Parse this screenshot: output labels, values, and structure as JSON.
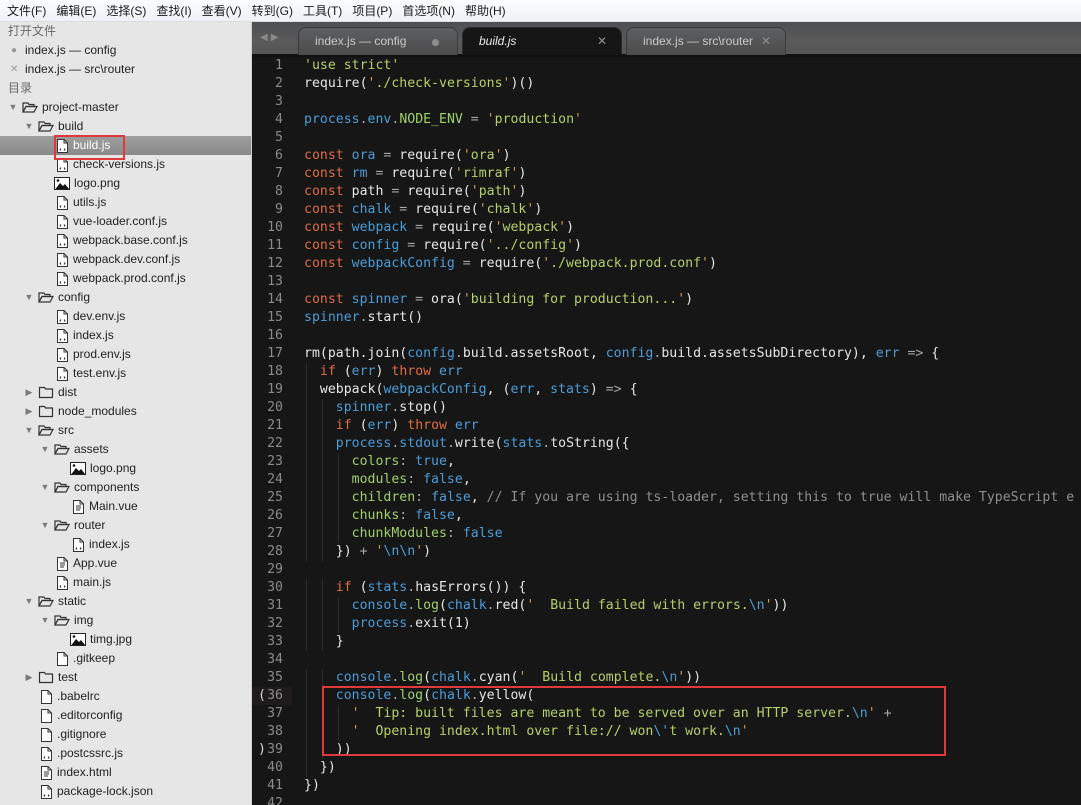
{
  "menu": [
    "文件(F)",
    "编辑(E)",
    "选择(S)",
    "查找(I)",
    "查看(V)",
    "转到(G)",
    "工具(T)",
    "项目(P)",
    "首选项(N)",
    "帮助(H)"
  ],
  "sidebar": {
    "open_files_heading": "打开文件",
    "open_files": [
      {
        "label": "index.js — config",
        "mark": "●"
      },
      {
        "label": "index.js — src\\router",
        "mark": "✕"
      }
    ],
    "folders_heading": "目录",
    "tree": [
      {
        "label": "project-master",
        "type": "folder-open",
        "depth": 0
      },
      {
        "label": "build",
        "type": "folder-open",
        "depth": 1
      },
      {
        "label": "build.js",
        "type": "js",
        "depth": 2,
        "selected": true
      },
      {
        "label": "check-versions.js",
        "type": "js",
        "depth": 2
      },
      {
        "label": "logo.png",
        "type": "image",
        "depth": 2
      },
      {
        "label": "utils.js",
        "type": "js",
        "depth": 2
      },
      {
        "label": "vue-loader.conf.js",
        "type": "js",
        "depth": 2
      },
      {
        "label": "webpack.base.conf.js",
        "type": "js",
        "depth": 2
      },
      {
        "label": "webpack.dev.conf.js",
        "type": "js",
        "depth": 2
      },
      {
        "label": "webpack.prod.conf.js",
        "type": "js",
        "depth": 2
      },
      {
        "label": "config",
        "type": "folder-open",
        "depth": 1
      },
      {
        "label": "dev.env.js",
        "type": "js",
        "depth": 2
      },
      {
        "label": "index.js",
        "type": "js",
        "depth": 2
      },
      {
        "label": "prod.env.js",
        "type": "js",
        "depth": 2
      },
      {
        "label": "test.env.js",
        "type": "js",
        "depth": 2
      },
      {
        "label": "dist",
        "type": "folder-closed",
        "depth": 1
      },
      {
        "label": "node_modules",
        "type": "folder-closed",
        "depth": 1
      },
      {
        "label": "src",
        "type": "folder-open",
        "depth": 1
      },
      {
        "label": "assets",
        "type": "folder-open",
        "depth": 2
      },
      {
        "label": "logo.png",
        "type": "image",
        "depth": 3
      },
      {
        "label": "components",
        "type": "folder-open",
        "depth": 2
      },
      {
        "label": "Main.vue",
        "type": "markup",
        "depth": 3
      },
      {
        "label": "router",
        "type": "folder-open",
        "depth": 2
      },
      {
        "label": "index.js",
        "type": "js",
        "depth": 3
      },
      {
        "label": "App.vue",
        "type": "markup",
        "depth": 2
      },
      {
        "label": "main.js",
        "type": "js",
        "depth": 2
      },
      {
        "label": "static",
        "type": "folder-open",
        "depth": 1
      },
      {
        "label": "img",
        "type": "folder-open",
        "depth": 2
      },
      {
        "label": "timg.jpg",
        "type": "image",
        "depth": 3
      },
      {
        "label": ".gitkeep",
        "type": "file",
        "depth": 2
      },
      {
        "label": "test",
        "type": "folder-closed",
        "depth": 1
      },
      {
        "label": ".babelrc",
        "type": "file",
        "depth": 1
      },
      {
        "label": ".editorconfig",
        "type": "file",
        "depth": 1
      },
      {
        "label": ".gitignore",
        "type": "file",
        "depth": 1
      },
      {
        "label": ".postcssrc.js",
        "type": "js",
        "depth": 1
      },
      {
        "label": "index.html",
        "type": "markup",
        "depth": 1
      },
      {
        "label": "package-lock.json",
        "type": "js",
        "depth": 1
      }
    ]
  },
  "tabs": [
    {
      "label": "index.js — config",
      "dirty": true,
      "active": false
    },
    {
      "label": "build.js",
      "dirty": false,
      "active": true
    },
    {
      "label": "index.js — src\\router",
      "dirty": false,
      "active": false
    }
  ],
  "editor": {
    "current_line": 36,
    "bracket_marks": {
      "36": "(",
      "39": ")"
    },
    "lines": [
      [
        [
          "s",
          "'use strict'"
        ]
      ],
      [
        [
          "p",
          "require("
        ],
        [
          "q",
          "'"
        ],
        [
          "s",
          "./check-versions"
        ],
        [
          "q",
          "'"
        ],
        [
          "p",
          ")()"
        ]
      ],
      [],
      [
        [
          "v",
          "process"
        ],
        [
          "o",
          "."
        ],
        [
          "v",
          "env"
        ],
        [
          "o",
          "."
        ],
        [
          "g",
          "NODE_ENV"
        ],
        [
          "o",
          " = "
        ],
        [
          "q",
          "'"
        ],
        [
          "s",
          "production"
        ],
        [
          "q",
          "'"
        ]
      ],
      [],
      [
        [
          "k",
          "const "
        ],
        [
          "v",
          "ora"
        ],
        [
          "o",
          " = "
        ],
        [
          "p",
          "require("
        ],
        [
          "q",
          "'"
        ],
        [
          "s",
          "ora"
        ],
        [
          "q",
          "'"
        ],
        [
          "p",
          ")"
        ]
      ],
      [
        [
          "k",
          "const "
        ],
        [
          "v",
          "rm"
        ],
        [
          "o",
          " = "
        ],
        [
          "p",
          "require("
        ],
        [
          "q",
          "'"
        ],
        [
          "s",
          "rimraf"
        ],
        [
          "q",
          "'"
        ],
        [
          "p",
          ")"
        ]
      ],
      [
        [
          "k",
          "const "
        ],
        [
          "p",
          "path"
        ],
        [
          "o",
          " = "
        ],
        [
          "p",
          "require("
        ],
        [
          "q",
          "'"
        ],
        [
          "s",
          "path"
        ],
        [
          "q",
          "'"
        ],
        [
          "p",
          ")"
        ]
      ],
      [
        [
          "k",
          "const "
        ],
        [
          "v",
          "chalk"
        ],
        [
          "o",
          " = "
        ],
        [
          "p",
          "require("
        ],
        [
          "q",
          "'"
        ],
        [
          "s",
          "chalk"
        ],
        [
          "q",
          "'"
        ],
        [
          "p",
          ")"
        ]
      ],
      [
        [
          "k",
          "const "
        ],
        [
          "v",
          "webpack"
        ],
        [
          "o",
          " = "
        ],
        [
          "p",
          "require("
        ],
        [
          "q",
          "'"
        ],
        [
          "s",
          "webpack"
        ],
        [
          "q",
          "'"
        ],
        [
          "p",
          ")"
        ]
      ],
      [
        [
          "k",
          "const "
        ],
        [
          "v",
          "config"
        ],
        [
          "o",
          " = "
        ],
        [
          "p",
          "require("
        ],
        [
          "q",
          "'"
        ],
        [
          "s",
          "../config"
        ],
        [
          "q",
          "'"
        ],
        [
          "p",
          ")"
        ]
      ],
      [
        [
          "k",
          "const "
        ],
        [
          "v",
          "webpackConfig"
        ],
        [
          "o",
          " = "
        ],
        [
          "p",
          "require("
        ],
        [
          "q",
          "'"
        ],
        [
          "s",
          "./webpack.prod.conf"
        ],
        [
          "q",
          "'"
        ],
        [
          "p",
          ")"
        ]
      ],
      [],
      [
        [
          "k",
          "const "
        ],
        [
          "v",
          "spinner"
        ],
        [
          "o",
          " = "
        ],
        [
          "p",
          "ora("
        ],
        [
          "q",
          "'"
        ],
        [
          "s",
          "building for production..."
        ],
        [
          "q",
          "'"
        ],
        [
          "p",
          ")"
        ]
      ],
      [
        [
          "v",
          "spinner"
        ],
        [
          "o",
          "."
        ],
        [
          "p",
          "start()"
        ]
      ],
      [],
      [
        [
          "p",
          "rm(path.join("
        ],
        [
          "v",
          "config"
        ],
        [
          "o",
          "."
        ],
        [
          "p",
          "build.assetsRoot, "
        ],
        [
          "v",
          "config"
        ],
        [
          "o",
          "."
        ],
        [
          "p",
          "build.assetsSubDirectory), "
        ],
        [
          "v",
          "err"
        ],
        [
          "o",
          " => "
        ],
        [
          "p",
          "{"
        ]
      ],
      [
        [
          "p",
          "  "
        ],
        [
          "k",
          "if "
        ],
        [
          "p",
          "("
        ],
        [
          "v",
          "err"
        ],
        [
          "p",
          ") "
        ],
        [
          "k",
          "throw "
        ],
        [
          "v",
          "err"
        ]
      ],
      [
        [
          "p",
          "  webpack("
        ],
        [
          "v",
          "webpackConfig"
        ],
        [
          "p",
          ", ("
        ],
        [
          "v",
          "err"
        ],
        [
          "p",
          ", "
        ],
        [
          "v",
          "stats"
        ],
        [
          "p",
          ") "
        ],
        [
          "o",
          "=> "
        ],
        [
          "p",
          "{"
        ]
      ],
      [
        [
          "p",
          "    "
        ],
        [
          "v",
          "spinner"
        ],
        [
          "o",
          "."
        ],
        [
          "p",
          "stop()"
        ]
      ],
      [
        [
          "p",
          "    "
        ],
        [
          "k",
          "if "
        ],
        [
          "p",
          "("
        ],
        [
          "v",
          "err"
        ],
        [
          "p",
          ") "
        ],
        [
          "k",
          "throw "
        ],
        [
          "v",
          "err"
        ]
      ],
      [
        [
          "p",
          "    "
        ],
        [
          "v",
          "process"
        ],
        [
          "o",
          "."
        ],
        [
          "v",
          "stdout"
        ],
        [
          "o",
          "."
        ],
        [
          "p",
          "write("
        ],
        [
          "v",
          "stats"
        ],
        [
          "o",
          "."
        ],
        [
          "p",
          "toString({"
        ]
      ],
      [
        [
          "p",
          "      "
        ],
        [
          "g",
          "colors"
        ],
        [
          "o",
          ": "
        ],
        [
          "b",
          "true"
        ],
        [
          "p",
          ","
        ]
      ],
      [
        [
          "p",
          "      "
        ],
        [
          "g",
          "modules"
        ],
        [
          "o",
          ": "
        ],
        [
          "b",
          "false"
        ],
        [
          "p",
          ","
        ]
      ],
      [
        [
          "p",
          "      "
        ],
        [
          "g",
          "children"
        ],
        [
          "o",
          ": "
        ],
        [
          "b",
          "false"
        ],
        [
          "p",
          ", "
        ],
        [
          "c",
          "// If you are using ts-loader, setting this to true will make TypeScript e"
        ]
      ],
      [
        [
          "p",
          "      "
        ],
        [
          "g",
          "chunks"
        ],
        [
          "o",
          ": "
        ],
        [
          "b",
          "false"
        ],
        [
          "p",
          ","
        ]
      ],
      [
        [
          "p",
          "      "
        ],
        [
          "g",
          "chunkModules"
        ],
        [
          "o",
          ": "
        ],
        [
          "b",
          "false"
        ]
      ],
      [
        [
          "p",
          "    }) "
        ],
        [
          "o",
          "+ "
        ],
        [
          "q",
          "'"
        ],
        [
          "e",
          "\\n\\n"
        ],
        [
          "q",
          "'"
        ],
        [
          "p",
          ")"
        ]
      ],
      [],
      [
        [
          "p",
          "    "
        ],
        [
          "k",
          "if "
        ],
        [
          "p",
          "("
        ],
        [
          "v",
          "stats"
        ],
        [
          "o",
          "."
        ],
        [
          "p",
          "hasErrors()) {"
        ]
      ],
      [
        [
          "p",
          "      "
        ],
        [
          "v",
          "console"
        ],
        [
          "o",
          "."
        ],
        [
          "g",
          "log"
        ],
        [
          "p",
          "("
        ],
        [
          "v",
          "chalk"
        ],
        [
          "o",
          "."
        ],
        [
          "p",
          "red("
        ],
        [
          "q",
          "'"
        ],
        [
          "s",
          "  Build failed with errors."
        ],
        [
          "e",
          "\\n"
        ],
        [
          "q",
          "'"
        ],
        [
          "p",
          "))"
        ]
      ],
      [
        [
          "p",
          "      "
        ],
        [
          "v",
          "process"
        ],
        [
          "o",
          "."
        ],
        [
          "p",
          "exit(1)"
        ]
      ],
      [
        [
          "p",
          "    }"
        ]
      ],
      [],
      [
        [
          "p",
          "    "
        ],
        [
          "v",
          "console"
        ],
        [
          "o",
          "."
        ],
        [
          "g",
          "log"
        ],
        [
          "p",
          "("
        ],
        [
          "v",
          "chalk"
        ],
        [
          "o",
          "."
        ],
        [
          "p",
          "cyan("
        ],
        [
          "q",
          "'"
        ],
        [
          "s",
          "  Build complete."
        ],
        [
          "e",
          "\\n"
        ],
        [
          "q",
          "'"
        ],
        [
          "p",
          "))"
        ]
      ],
      [
        [
          "p",
          "    "
        ],
        [
          "v",
          "console"
        ],
        [
          "o",
          "."
        ],
        [
          "g",
          "log"
        ],
        [
          "p",
          "("
        ],
        [
          "v",
          "chalk"
        ],
        [
          "o",
          "."
        ],
        [
          "p",
          "yellow("
        ]
      ],
      [
        [
          "p",
          "      "
        ],
        [
          "q",
          "'"
        ],
        [
          "s",
          "  Tip: built files are meant to be served over an HTTP server."
        ],
        [
          "e",
          "\\n"
        ],
        [
          "q",
          "'"
        ],
        [
          "o",
          " +"
        ]
      ],
      [
        [
          "p",
          "      "
        ],
        [
          "q",
          "'"
        ],
        [
          "s",
          "  Opening index.html over file:// won"
        ],
        [
          "e",
          "\\'"
        ],
        [
          "s",
          "t work."
        ],
        [
          "e",
          "\\n"
        ],
        [
          "q",
          "'"
        ]
      ],
      [
        [
          "p",
          "    ))"
        ]
      ],
      [
        [
          "p",
          "  })"
        ]
      ],
      [
        [
          "p",
          "})"
        ]
      ],
      []
    ]
  },
  "annotations": {
    "highlight_color": "#e0393c"
  }
}
